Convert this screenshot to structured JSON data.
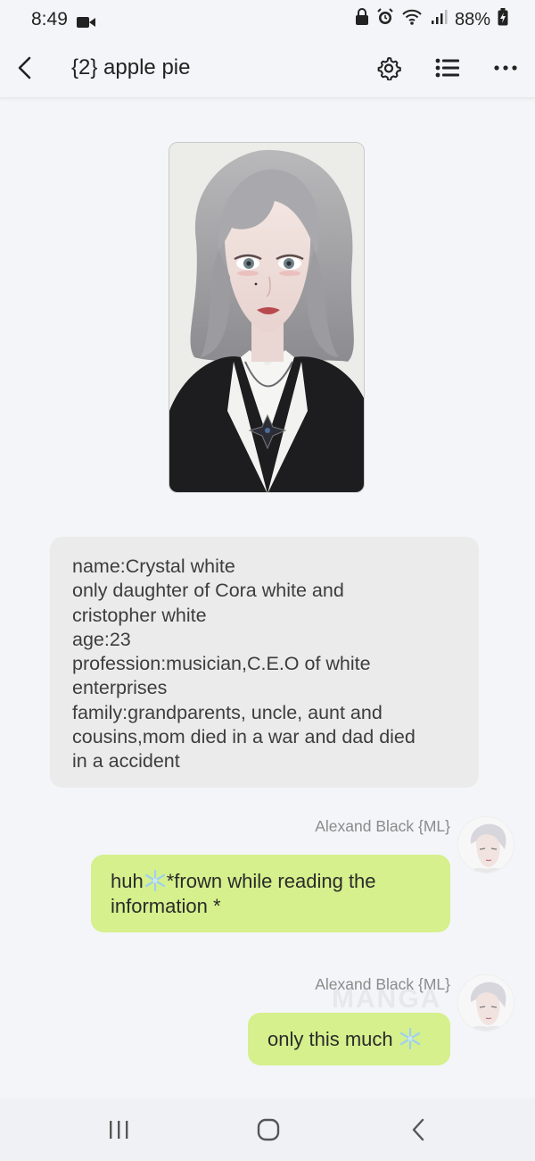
{
  "status_bar": {
    "time": "8:49",
    "battery": "88%"
  },
  "header": {
    "title": "{2} apple pie"
  },
  "character_info": {
    "lines": [
      "name:Crystal white",
      "only daughter of Cora white and",
      "cristopher white",
      "age:23",
      "profession:musician,C.E.O of white",
      "enterprises",
      "family:grandparents, uncle, aunt and",
      "cousins,mom died in a war and dad died",
      "in a accident"
    ]
  },
  "messages": [
    {
      "sender": "Alexand Black {ML}",
      "line1_a": "huh",
      "line1_b": "*frown while reading the",
      "line2": "information *"
    },
    {
      "sender": "Alexand Black {ML}",
      "text": "only this much"
    }
  ],
  "watermark": "MANGA",
  "icons": {
    "back": "back-arrow-icon",
    "settings": "gear-icon",
    "list": "list-icon",
    "more": "more-dots-icon",
    "snowflake": "snowflake-emoji",
    "nav_recents": "recents-icon",
    "nav_home": "home-icon",
    "nav_back": "nav-back-icon"
  },
  "colors": {
    "user_bubble": "#d5f08c",
    "info_bubble": "#ebebec",
    "background": "#f4f5f8"
  }
}
